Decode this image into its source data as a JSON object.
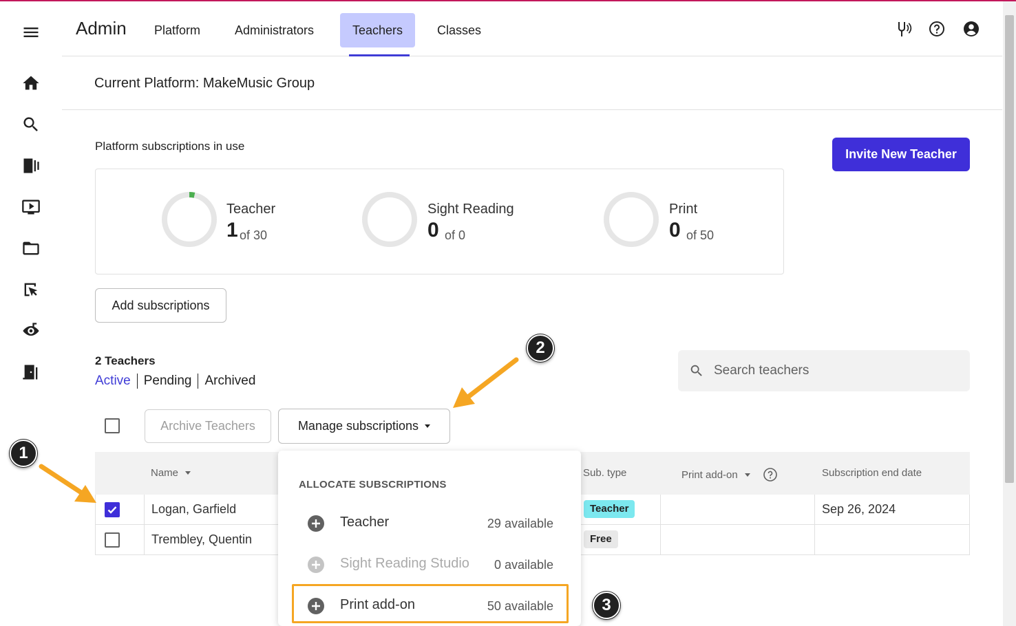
{
  "header": {
    "app_title": "Admin",
    "tabs": [
      {
        "label": "Platform"
      },
      {
        "label": "Administrators"
      },
      {
        "label": "Teachers"
      },
      {
        "label": "Classes"
      }
    ]
  },
  "platform": {
    "title": "Current Platform: MakeMusic Group"
  },
  "subscriptions": {
    "section_label": "Platform subscriptions in use",
    "items": [
      {
        "name": "Teacher",
        "used": "1",
        "of_text": "of 30",
        "fraction": 0.0333
      },
      {
        "name": "Sight Reading",
        "used": "0",
        "of_text": "of 0",
        "fraction": 0
      },
      {
        "name": "Print",
        "used": "0",
        "of_text": "of 50",
        "fraction": 0
      }
    ],
    "add_button": "Add subscriptions"
  },
  "invite_button": "Invite New Teacher",
  "teachers": {
    "count_label": "2 Teachers",
    "filters": [
      "Active",
      "Pending",
      "Archived"
    ],
    "search_placeholder": "Search teachers",
    "archive_button": "Archive Teachers",
    "manage_button": "Manage subscriptions"
  },
  "table": {
    "columns": {
      "name": "Name",
      "sub_type": "Sub. type",
      "print_addon": "Print add-on",
      "end_date": "Subscription end date"
    },
    "rows": [
      {
        "name": "Logan, Garfield",
        "sub_type": "Teacher",
        "print_addon": "",
        "end_date": "Sep 26, 2024",
        "checked": true
      },
      {
        "name": "Trembley, Quentin",
        "sub_type": "Free",
        "print_addon": "",
        "end_date": "",
        "checked": false
      }
    ]
  },
  "dropdown": {
    "heading": "ALLOCATE SUBSCRIPTIONS",
    "items": [
      {
        "label": "Teacher",
        "available": "29 available"
      },
      {
        "label": "Sight Reading Studio",
        "available": "0 available"
      },
      {
        "label": "Print add-on",
        "available": "50 available"
      }
    ]
  },
  "annotations": [
    "1",
    "2",
    "3"
  ],
  "colors": {
    "accent": "#3f2fd9",
    "active_tab_bg": "#c5cafe",
    "teacher_badge": "#7ce8ef",
    "free_badge": "#e8e8e8",
    "ring_progress": "#4caf50",
    "highlight": "#f5a623"
  }
}
